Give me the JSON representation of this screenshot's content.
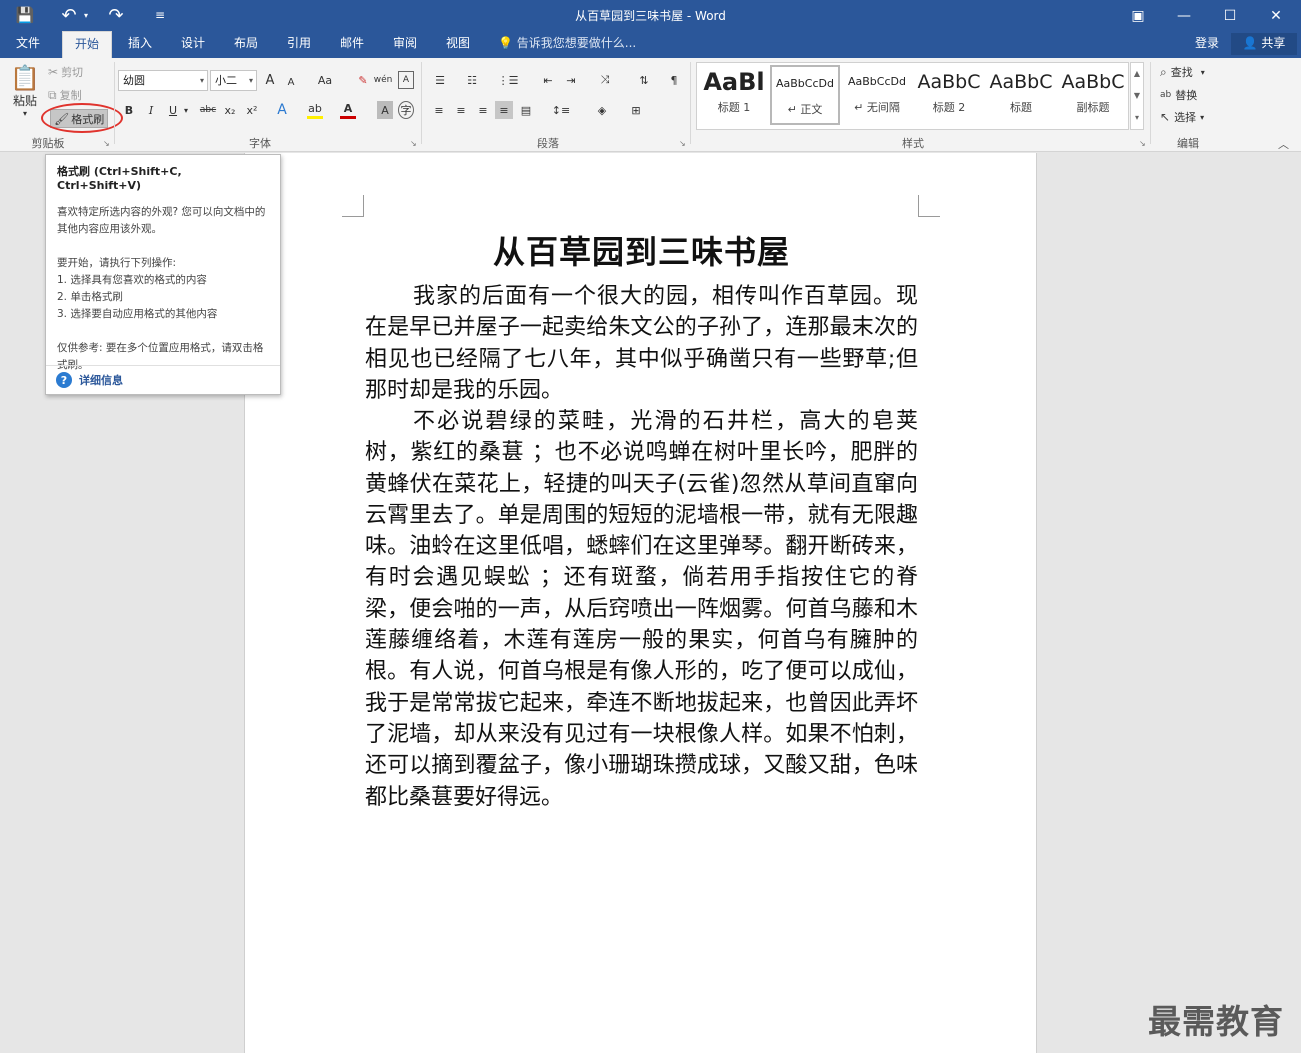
{
  "titlebar": {
    "title": "从百草园到三味书屋 - Word",
    "save_icon": "💾",
    "undo_icon": "↶",
    "redo_icon": "↷",
    "customize_icon": "≡",
    "ribbon_options_icon": "▣",
    "minimize_icon": "—",
    "maximize_icon": "☐",
    "close_icon": "✕"
  },
  "tabs": [
    "文件",
    "开始",
    "插入",
    "设计",
    "布局",
    "引用",
    "邮件",
    "审阅",
    "视图"
  ],
  "tell_me": "告诉我您想要做什么...",
  "account": {
    "login": "登录",
    "share": "共享"
  },
  "clipboard": {
    "paste": "粘贴",
    "cut": "剪切",
    "copy": "复制",
    "format_painter": "格式刷",
    "label": "剪贴板"
  },
  "font": {
    "name": "幼圆",
    "size": "小二",
    "label": "字体",
    "grow": "A",
    "shrink": "A",
    "case": "Aa",
    "bold": "B",
    "italic": "I",
    "underline": "U",
    "strike": "abc",
    "subscript": "x₂",
    "superscript": "x²"
  },
  "paragraph": {
    "label": "段落"
  },
  "styles": {
    "label": "样式",
    "items": [
      {
        "preview": "AaBl",
        "name": "标题 1"
      },
      {
        "preview": "AaBbCcDd",
        "name": "↵ 正文"
      },
      {
        "preview": "AaBbCcDd",
        "name": "↵ 无间隔"
      },
      {
        "preview": "AaBbC",
        "name": "标题 2"
      },
      {
        "preview": "AaBbC",
        "name": "标题"
      },
      {
        "preview": "AaBbC",
        "name": "副标题"
      }
    ]
  },
  "editing": {
    "label": "编辑",
    "find": "查找",
    "replace": "替换",
    "select": "选择"
  },
  "tooltip": {
    "title": "格式刷 (Ctrl+Shift+C, Ctrl+Shift+V)",
    "desc": "喜欢特定所选内容的外观? 您可以向文档中的其他内容应用该外观。",
    "steps_intro": "要开始，请执行下列操作:",
    "step1": "1. 选择具有您喜欢的格式的内容",
    "step2": "2. 单击格式刷",
    "step3": "3. 选择要自动应用格式的其他内容",
    "note": "仅供参考: 要在多个位置应用格式，请双击格式刷。",
    "more": "详细信息"
  },
  "document": {
    "title": "从百草园到三味书屋",
    "para1": "我家的后面有一个很大的园，相传叫作百草园。现在是早已并屋子一起卖给朱文公的子孙了，连那最末次的相见也已经隔了七八年，其中似乎确凿只有一些野草;但那时却是我的乐园。",
    "para2": "不必说碧绿的菜畦，光滑的石井栏，高大的皂荚树，紫红的桑葚 ；也不必说鸣蝉在树叶里长吟，肥胖的黄蜂伏在菜花上，轻捷的叫天子(云雀)忽然从草间直窜向云霄里去了。单是周围的短短的泥墙根一带，就有无限趣味。油蛉在这里低唱，蟋蟀们在这里弹琴。翻开断砖来，有时会遇见蜈蚣 ；还有斑蝥，倘若用手指按住它的脊梁，便会啪的一声，从后窍喷出一阵烟雾。何首乌藤和木莲藤缠络着，木莲有莲房一般的果实，何首乌有臃肿的根。有人说，何首乌根是有像人形的，吃了便可以成仙，我于是常常拔它起来，牵连不断地拔起来，也曾因此弄坏了泥墙，却从来没有见过有一块根像人样。如果不怕刺，还可以摘到覆盆子，像小珊瑚珠攒成球，又酸又甜，色味都比桑葚要好得远。"
  },
  "watermark": "最需教育",
  "colors": {
    "brand": "#2b579a",
    "highlight_circle": "#e0332d"
  }
}
